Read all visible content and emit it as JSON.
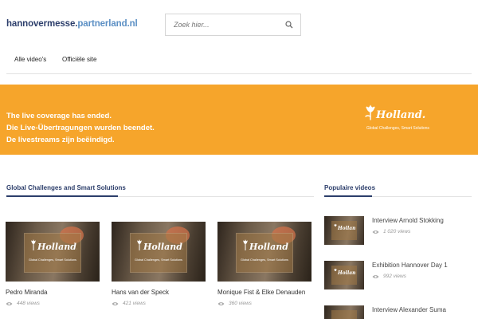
{
  "site": {
    "logo_part1": "hannovermesse.",
    "logo_part2": "partnerland.nl"
  },
  "search": {
    "placeholder": "Zoek hier..."
  },
  "nav": {
    "items": [
      {
        "label": "Alle video's"
      },
      {
        "label": "Officiële site"
      }
    ]
  },
  "banner": {
    "lines": [
      "The live coverage has ended.",
      "Die Live-Übertragungen wurden beendet.",
      "De livestreams zijn beëindigd."
    ],
    "brand": "Holland.",
    "tagline": "Global Challenges, Smart Solutions"
  },
  "main": {
    "section_title": "Global Challenges and Smart Solutions",
    "thumb_caption": "Global Challenges, Smart Solutions",
    "videos": [
      {
        "title": "Pedro Miranda",
        "views": "448 views"
      },
      {
        "title": "Hans van der Speck",
        "views": "421 views"
      },
      {
        "title": "Monique Fist & Elke Denauden",
        "views": "360 views"
      }
    ]
  },
  "sidebar": {
    "section_title": "Populaire videos",
    "videos": [
      {
        "title": "Interview Arnold Stokking",
        "views": "1 020 views"
      },
      {
        "title": "Exhibition Hannover Day 1",
        "views": "992 views"
      },
      {
        "title": "Interview Alexander Suma",
        "views": ""
      }
    ]
  },
  "colors": {
    "accent": "#f6a52b",
    "brand_dark": "#2c3e6b",
    "brand_light": "#5b8fc4"
  },
  "icons": {
    "search": "search-icon",
    "views": "eye-icon",
    "brand": "tulip-icon"
  }
}
